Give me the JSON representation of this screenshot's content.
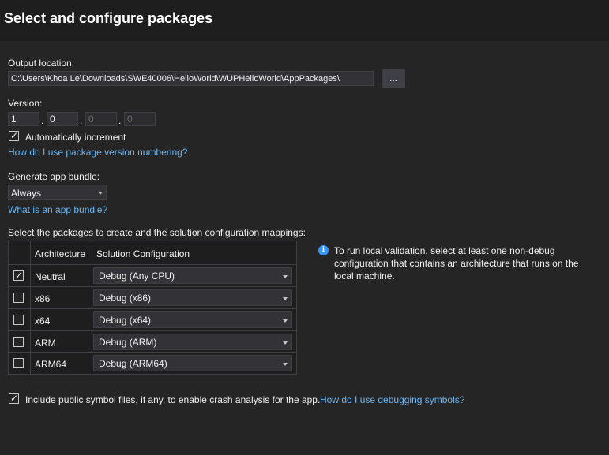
{
  "header": {
    "title": "Select and configure packages"
  },
  "output": {
    "label": "Output location:",
    "path": "C:\\Users\\Khoa Le\\Downloads\\SWE40006\\HelloWorld\\WUPHelloWorld\\AppPackages\\",
    "browse_label": "..."
  },
  "version": {
    "label": "Version:",
    "major": "1",
    "minor": "0",
    "build": "0",
    "revision": "0",
    "separator": ".",
    "auto_increment_label": "Automatically increment",
    "auto_increment_checked": true,
    "help_link": "How do I use package version numbering?"
  },
  "bundle": {
    "label": "Generate app bundle:",
    "selected": "Always",
    "help_link": "What is an app bundle?"
  },
  "packages": {
    "label": "Select the packages to create and the solution configuration mappings:",
    "col_architecture": "Architecture",
    "col_configuration": "Solution Configuration",
    "rows": [
      {
        "checked": true,
        "architecture": "Neutral",
        "configuration": "Debug (Any CPU)"
      },
      {
        "checked": false,
        "architecture": "x86",
        "configuration": "Debug (x86)"
      },
      {
        "checked": false,
        "architecture": "x64",
        "configuration": "Debug (x64)"
      },
      {
        "checked": false,
        "architecture": "ARM",
        "configuration": "Debug (ARM)"
      },
      {
        "checked": false,
        "architecture": "ARM64",
        "configuration": "Debug (ARM64)"
      }
    ]
  },
  "info": {
    "icon": "info-icon",
    "text": "To run local validation, select at least one non-debug configuration that contains an architecture that runs on the local machine."
  },
  "symbols": {
    "checked": true,
    "label": "Include public symbol files, if any, to enable crash analysis for the app.",
    "help_link": "How do I use debugging symbols?"
  },
  "colors": {
    "background": "#252526",
    "header": "#1e1e1e",
    "link": "#6cb4ee",
    "info": "#3794ff"
  }
}
